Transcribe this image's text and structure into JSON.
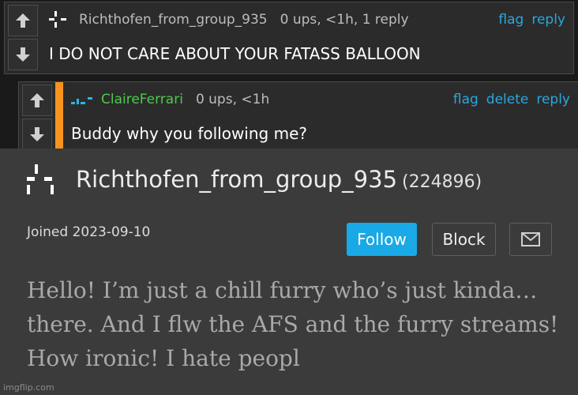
{
  "comments": [
    {
      "username": "Richthofen_from_group_935",
      "username_color": "#bdbdbd",
      "meta": "0 ups, <1h, 1 reply",
      "actions": [
        "flag",
        "reply"
      ],
      "text": "I DO NOT CARE ABOUT YOUR FATASS BALLOON",
      "identicon_color": "#ffffff"
    },
    {
      "username": "ClaireFerrari",
      "username_color": "#4cc94a",
      "meta": "0 ups, <1h",
      "actions": [
        "flag",
        "delete",
        "reply"
      ],
      "text": "Buddy why you following me?",
      "identicon_color": "#29b6e8"
    }
  ],
  "profile": {
    "username": "Richthofen_from_group_935",
    "score": "(224896)",
    "joined": "Joined 2023-09-10",
    "follow_label": "Follow",
    "block_label": "Block",
    "mail_icon": "mail-icon",
    "bio": "Hello! I’m just a chill furry who’s just kinda… there. And I flw the AFS and the furry streams! How ironic! I hate peopl"
  },
  "colors": {
    "accent_orange": "#f7941d",
    "link_blue": "#2aa7e0",
    "follow_blue": "#19a9e6"
  },
  "watermark": "imgflip.com"
}
